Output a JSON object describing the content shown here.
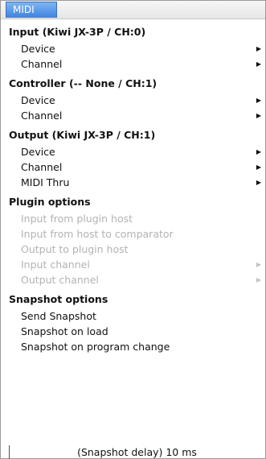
{
  "tab": {
    "label": "MIDI"
  },
  "input": {
    "header": "Input (Kiwi JX-3P / CH:0)",
    "device": "Device",
    "channel": "Channel"
  },
  "controller": {
    "header": "Controller (-- None / CH:1)",
    "device": "Device",
    "channel": "Channel"
  },
  "output": {
    "header": "Output  (Kiwi JX-3P / CH:1)",
    "device": "Device",
    "channel": "Channel",
    "midi_thru": "MIDI Thru"
  },
  "plugin_options": {
    "header": "Plugin options",
    "items": [
      "Input from plugin host",
      "Input from host to comparator",
      "Output to plugin host",
      "Input channel",
      "Output channel"
    ]
  },
  "snapshot_options": {
    "header": "Snapshot options",
    "items": [
      "Send Snapshot",
      "Snapshot on load",
      "Snapshot on program change"
    ],
    "delay": "(Snapshot delay) 10 ms"
  },
  "submenu_arrow": "▶",
  "colors": {
    "tab_active": "#3f83de",
    "disabled_text": "#b3b3b3"
  }
}
